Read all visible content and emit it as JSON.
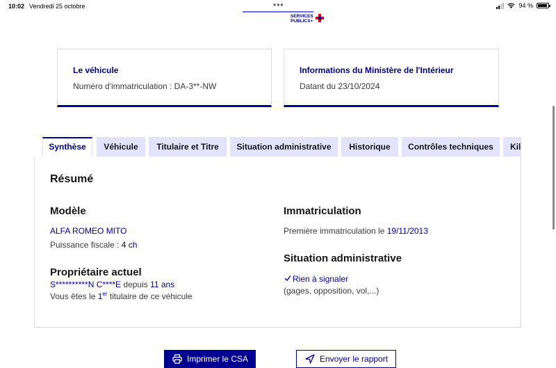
{
  "status_bar": {
    "time": "10:02",
    "date": "Vendredi 25 octobre",
    "battery": "94 %"
  },
  "logo": {
    "line1": "SERVICES",
    "line2": "PUBLICS+"
  },
  "cards": {
    "vehicle": {
      "title": "Le véhicule",
      "text": "Numéro d'immatriculation : DA-3**-NW"
    },
    "ministry": {
      "title": "Informations du Ministère de l'Intérieur",
      "text": "Datant du 23/10/2024"
    }
  },
  "tabs": [
    "Synthèse",
    "Véhicule",
    "Titulaire et Titre",
    "Situation administrative",
    "Historique",
    "Contrôles techniques",
    "Kilo"
  ],
  "summary": {
    "title": "Résumé",
    "model": {
      "heading": "Modèle",
      "name": "ALFA ROMEO MITO",
      "power_label": "Puissance fiscale : ",
      "power_value": "4 ch"
    },
    "owner": {
      "heading": "Propriétaire actuel",
      "name": "S**********N C****E",
      "since_label": " depuis ",
      "since_value": "11 ans",
      "rank_prefix": "Vous êtes le ",
      "rank_num": "1",
      "rank_sup": "er",
      "rank_suffix": " titulaire de ce véhicule"
    },
    "registration": {
      "heading": "Immatriculation",
      "label": "Première immatriculation le ",
      "date": "19/11/2013"
    },
    "admin": {
      "heading": "Situation administrative",
      "status": "Rien à signaler",
      "detail": "(gages, opposition, vol,...)"
    }
  },
  "buttons": {
    "print": "Imprimer le CSA",
    "send": "Envoyer le rapport"
  },
  "colors": {
    "accent": "#000091",
    "tab_bg": "#e3e3fd"
  }
}
